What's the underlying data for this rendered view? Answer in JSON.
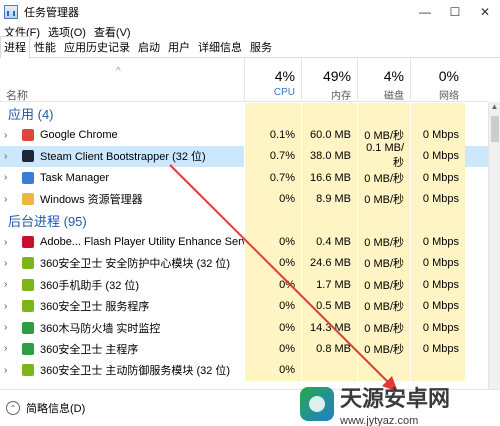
{
  "window": {
    "title": "任务管理器",
    "minimize": "—",
    "maximize": "☐",
    "close": "✕"
  },
  "menu": [
    "文件(F)",
    "选项(O)",
    "查看(V)"
  ],
  "tabs": [
    "进程",
    "性能",
    "应用历史记录",
    "启动",
    "用户",
    "详细信息",
    "服务"
  ],
  "active_tab": "进程",
  "header": {
    "name": "名称",
    "cpu": {
      "pct": "4%",
      "label": "CPU"
    },
    "mem": {
      "pct": "49%",
      "label": "内存"
    },
    "disk": {
      "pct": "4%",
      "label": "磁盘"
    },
    "net": {
      "pct": "0%",
      "label": "网络"
    }
  },
  "groups": {
    "apps": "应用 (4)",
    "background": "后台进程 (95)"
  },
  "apps": [
    {
      "name": "Google Chrome",
      "cpu": "0.1%",
      "mem": "60.0 MB",
      "disk": "0 MB/秒",
      "net": "0 Mbps",
      "icon": "chrome-icon",
      "color": "#e0443a"
    },
    {
      "name": "Steam Client Bootstrapper (32 位)",
      "cpu": "0.7%",
      "mem": "38.0 MB",
      "disk": "0.1 MB/秒",
      "net": "0 Mbps",
      "icon": "steam-icon",
      "color": "#1b2838"
    },
    {
      "name": "Task Manager",
      "cpu": "0.7%",
      "mem": "16.6 MB",
      "disk": "0 MB/秒",
      "net": "0 Mbps",
      "icon": "task-manager-icon",
      "color": "#3a7bd5"
    },
    {
      "name": "Windows 资源管理器",
      "cpu": "0%",
      "mem": "8.9 MB",
      "disk": "0 MB/秒",
      "net": "0 Mbps",
      "icon": "explorer-icon",
      "color": "#e8b93a"
    }
  ],
  "background": [
    {
      "name": "Adobe... Flash Player Utility Enhance Service",
      "cpu": "0%",
      "mem": "0.4 MB",
      "disk": "0 MB/秒",
      "net": "0 Mbps",
      "icon": "adobe-icon",
      "color": "#c8102e"
    },
    {
      "name": "360安全卫士 安全防护中心模块 (32 位)",
      "cpu": "0%",
      "mem": "24.6 MB",
      "disk": "0 MB/秒",
      "net": "0 Mbps",
      "icon": "shield-icon",
      "color": "#7cb518"
    },
    {
      "name": "360手机助手 (32 位)",
      "cpu": "0%",
      "mem": "1.7 MB",
      "disk": "0 MB/秒",
      "net": "0 Mbps",
      "icon": "phone-assistant-icon",
      "color": "#7cb518"
    },
    {
      "name": "360安全卫士 服务程序",
      "cpu": "0%",
      "mem": "0.5 MB",
      "disk": "0 MB/秒",
      "net": "0 Mbps",
      "icon": "service-icon",
      "color": "#7cb518"
    },
    {
      "name": "360木马防火墙 实时监控",
      "cpu": "0%",
      "mem": "14.3 MB",
      "disk": "0 MB/秒",
      "net": "0 Mbps",
      "icon": "firewall-icon",
      "color": "#2e9e44"
    },
    {
      "name": "360安全卫士 主程序",
      "cpu": "0%",
      "mem": "0.8 MB",
      "disk": "0 MB/秒",
      "net": "0 Mbps",
      "icon": "main-program-icon",
      "color": "#2e9e44"
    },
    {
      "name": "360安全卫士 主动防御服务模块 (32 位)",
      "cpu": "0%",
      "mem": "",
      "disk": "",
      "net": "",
      "icon": "defense-icon",
      "color": "#7cb518"
    }
  ],
  "footer": {
    "label": "简略信息(D)"
  },
  "watermark": {
    "title": "天源安卓网",
    "url": "www.jytyaz.com"
  }
}
